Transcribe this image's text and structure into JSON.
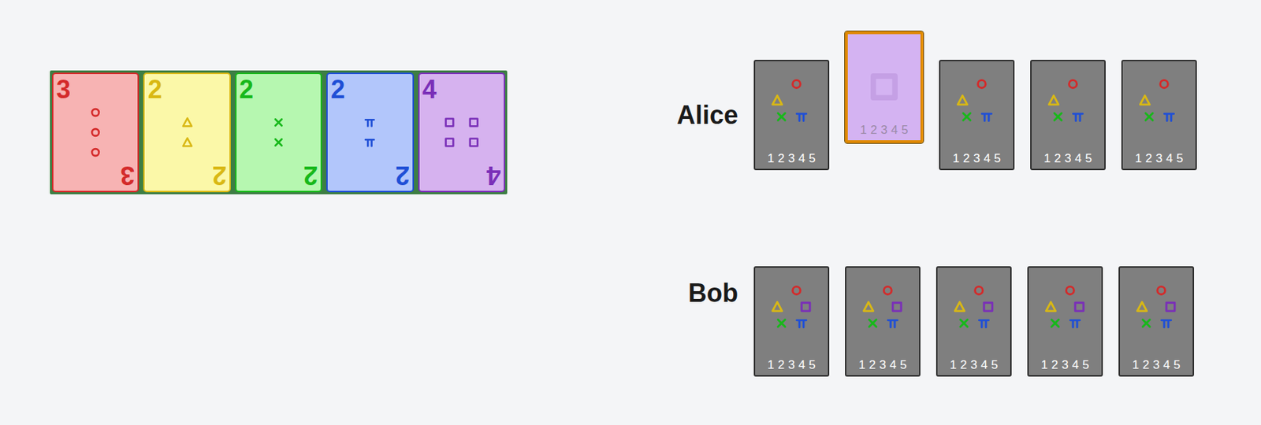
{
  "play_stacks": [
    {
      "suit": "red",
      "rank": "3",
      "color": "#d42a2a",
      "fill": "#f7b3b3"
    },
    {
      "suit": "yellow",
      "rank": "2",
      "color": "#d9b814",
      "fill": "#fbf8a8"
    },
    {
      "suit": "green",
      "rank": "2",
      "color": "#17b81a",
      "fill": "#b6f7b0"
    },
    {
      "suit": "blue",
      "rank": "2",
      "color": "#1f4fd6",
      "fill": "#b2c6fb"
    },
    {
      "suit": "purple",
      "rank": "4",
      "color": "#7a2fb8",
      "fill": "#d6b2ef"
    }
  ],
  "players": [
    {
      "name": "Alice",
      "cards": [
        {
          "kind": "unknown",
          "selected": false,
          "pips": [
            {
              "suit": "red",
              "color": "#d42a2a"
            },
            {
              "suit": "yellow",
              "color": "#d9b814"
            },
            {
              "suit": "green",
              "color": "#17b81a"
            },
            {
              "suit": "blue",
              "color": "#1f4fd6"
            }
          ],
          "ranks": [
            "1",
            "2",
            "3",
            "4",
            "5"
          ]
        },
        {
          "kind": "clued",
          "selected": true,
          "color": "#d4b3f2",
          "pips": [
            {
              "suit": "purple",
              "color": "#bf98e0"
            }
          ],
          "ranks": [
            "1",
            "2",
            "3",
            "4",
            "5"
          ]
        },
        {
          "kind": "unknown",
          "selected": false,
          "pips": [
            {
              "suit": "red",
              "color": "#d42a2a"
            },
            {
              "suit": "yellow",
              "color": "#d9b814"
            },
            {
              "suit": "green",
              "color": "#17b81a"
            },
            {
              "suit": "blue",
              "color": "#1f4fd6"
            }
          ],
          "ranks": [
            "1",
            "2",
            "3",
            "4",
            "5"
          ]
        },
        {
          "kind": "unknown",
          "selected": false,
          "pips": [
            {
              "suit": "red",
              "color": "#d42a2a"
            },
            {
              "suit": "yellow",
              "color": "#d9b814"
            },
            {
              "suit": "green",
              "color": "#17b81a"
            },
            {
              "suit": "blue",
              "color": "#1f4fd6"
            }
          ],
          "ranks": [
            "1",
            "2",
            "3",
            "4",
            "5"
          ]
        },
        {
          "kind": "unknown",
          "selected": false,
          "pips": [
            {
              "suit": "red",
              "color": "#d42a2a"
            },
            {
              "suit": "yellow",
              "color": "#d9b814"
            },
            {
              "suit": "green",
              "color": "#17b81a"
            },
            {
              "suit": "blue",
              "color": "#1f4fd6"
            }
          ],
          "ranks": [
            "1",
            "2",
            "3",
            "4",
            "5"
          ]
        }
      ]
    },
    {
      "name": "Bob",
      "cards": [
        {
          "kind": "unknown",
          "selected": false,
          "pips": [
            {
              "suit": "red",
              "color": "#d42a2a"
            },
            {
              "suit": "yellow",
              "color": "#d9b814"
            },
            {
              "suit": "purple",
              "color": "#7a2fb8"
            },
            {
              "suit": "green",
              "color": "#17b81a"
            },
            {
              "suit": "blue",
              "color": "#1f4fd6"
            }
          ],
          "ranks": [
            "1",
            "2",
            "3",
            "4",
            "5"
          ]
        },
        {
          "kind": "unknown",
          "selected": false,
          "pips": [
            {
              "suit": "red",
              "color": "#d42a2a"
            },
            {
              "suit": "yellow",
              "color": "#d9b814"
            },
            {
              "suit": "purple",
              "color": "#7a2fb8"
            },
            {
              "suit": "green",
              "color": "#17b81a"
            },
            {
              "suit": "blue",
              "color": "#1f4fd6"
            }
          ],
          "ranks": [
            "1",
            "2",
            "3",
            "4",
            "5"
          ]
        },
        {
          "kind": "unknown",
          "selected": false,
          "pips": [
            {
              "suit": "red",
              "color": "#d42a2a"
            },
            {
              "suit": "yellow",
              "color": "#d9b814"
            },
            {
              "suit": "purple",
              "color": "#7a2fb8"
            },
            {
              "suit": "green",
              "color": "#17b81a"
            },
            {
              "suit": "blue",
              "color": "#1f4fd6"
            }
          ],
          "ranks": [
            "1",
            "2",
            "3",
            "4",
            "5"
          ]
        },
        {
          "kind": "unknown",
          "selected": false,
          "pips": [
            {
              "suit": "red",
              "color": "#d42a2a"
            },
            {
              "suit": "yellow",
              "color": "#d9b814"
            },
            {
              "suit": "purple",
              "color": "#7a2fb8"
            },
            {
              "suit": "green",
              "color": "#17b81a"
            },
            {
              "suit": "blue",
              "color": "#1f4fd6"
            }
          ],
          "ranks": [
            "1",
            "2",
            "3",
            "4",
            "5"
          ]
        },
        {
          "kind": "unknown",
          "selected": false,
          "pips": [
            {
              "suit": "red",
              "color": "#d42a2a"
            },
            {
              "suit": "yellow",
              "color": "#d9b814"
            },
            {
              "suit": "purple",
              "color": "#7a2fb8"
            },
            {
              "suit": "green",
              "color": "#17b81a"
            },
            {
              "suit": "blue",
              "color": "#1f4fd6"
            }
          ],
          "ranks": [
            "1",
            "2",
            "3",
            "4",
            "5"
          ]
        }
      ]
    }
  ]
}
